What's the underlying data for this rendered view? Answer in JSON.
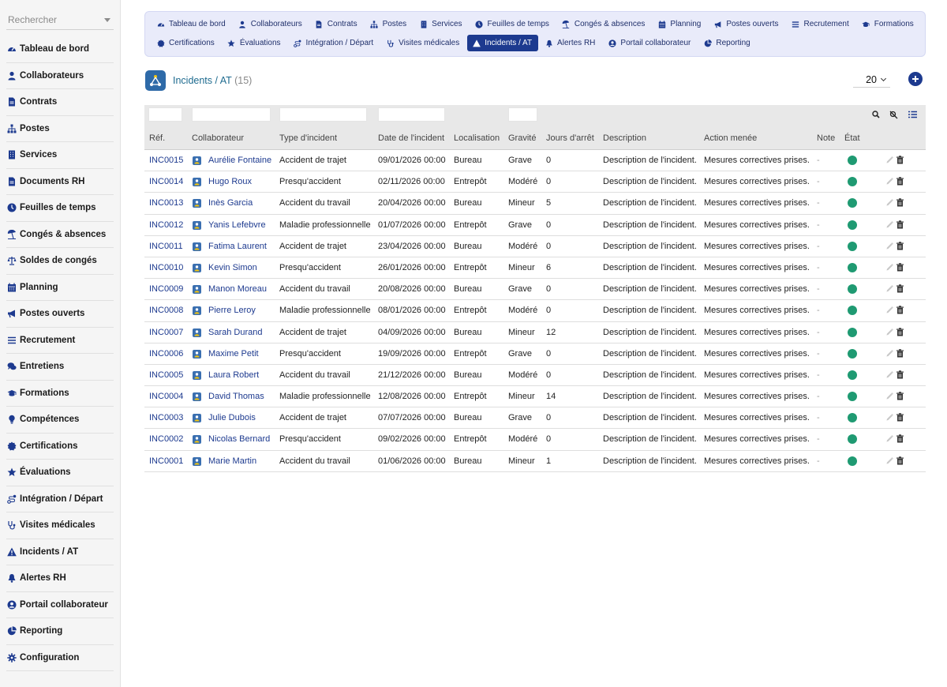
{
  "sidebar": {
    "search_placeholder": "Rechercher",
    "items": [
      {
        "label": "Tableau de bord",
        "icon": "dashboard-icon"
      },
      {
        "label": "Collaborateurs",
        "icon": "user-icon"
      },
      {
        "label": "Contrats",
        "icon": "document-icon"
      },
      {
        "label": "Postes",
        "icon": "sitemap-icon"
      },
      {
        "label": "Services",
        "icon": "building-icon"
      },
      {
        "label": "Documents RH",
        "icon": "document-icon"
      },
      {
        "label": "Feuilles de temps",
        "icon": "clock-icon"
      },
      {
        "label": "Congés & absences",
        "icon": "beach-umbrella-icon"
      },
      {
        "label": "Soldes de congés",
        "icon": "balance-scale-icon"
      },
      {
        "label": "Planning",
        "icon": "calendar-icon"
      },
      {
        "label": "Postes ouverts",
        "icon": "megaphone-icon"
      },
      {
        "label": "Recrutement",
        "icon": "list-icon"
      },
      {
        "label": "Entretiens",
        "icon": "chat-icon"
      },
      {
        "label": "Formations",
        "icon": "graduation-cap-icon"
      },
      {
        "label": "Compétences",
        "icon": "lightbulb-icon"
      },
      {
        "label": "Certifications",
        "icon": "certificate-icon"
      },
      {
        "label": "Évaluations",
        "icon": "star-icon"
      },
      {
        "label": "Intégration / Départ",
        "icon": "route-icon"
      },
      {
        "label": "Visites médicales",
        "icon": "stethoscope-icon"
      },
      {
        "label": "Incidents / AT",
        "icon": "warning-icon"
      },
      {
        "label": "Alertes RH",
        "icon": "bell-icon"
      },
      {
        "label": "Portail collaborateur",
        "icon": "user-circle-icon"
      },
      {
        "label": "Reporting",
        "icon": "pie-chart-icon"
      },
      {
        "label": "Configuration",
        "icon": "gear-icon"
      }
    ]
  },
  "topnav": {
    "row1": [
      {
        "label": "Tableau de bord",
        "icon": "dashboard-icon"
      },
      {
        "label": "Collaborateurs",
        "icon": "user-icon"
      },
      {
        "label": "Contrats",
        "icon": "document-icon"
      },
      {
        "label": "Postes",
        "icon": "sitemap-icon"
      },
      {
        "label": "Services",
        "icon": "building-icon"
      },
      {
        "label": "Feuilles de temps",
        "icon": "clock-icon"
      },
      {
        "label": "Congés & absences",
        "icon": "beach-umbrella-icon"
      },
      {
        "label": "Planning",
        "icon": "calendar-icon"
      },
      {
        "label": "Postes ouverts",
        "icon": "megaphone-icon"
      },
      {
        "label": "Recrutement",
        "icon": "list-icon"
      },
      {
        "label": "Formations",
        "icon": "graduation-cap-icon"
      }
    ],
    "row2": [
      {
        "label": "Certifications",
        "icon": "certificate-icon"
      },
      {
        "label": "Évaluations",
        "icon": "star-icon"
      },
      {
        "label": "Intégration / Départ",
        "icon": "route-icon"
      },
      {
        "label": "Visites médicales",
        "icon": "stethoscope-icon"
      },
      {
        "label": "Incidents / AT",
        "icon": "warning-icon",
        "active": true
      },
      {
        "label": "Alertes RH",
        "icon": "bell-icon"
      },
      {
        "label": "Portail collaborateur",
        "icon": "user-circle-icon"
      },
      {
        "label": "Reporting",
        "icon": "pie-chart-icon"
      }
    ]
  },
  "page": {
    "title": "Incidents / AT",
    "count": "(15)",
    "per_page": "20"
  },
  "colors": {
    "accent": "#1d3a8f",
    "nav_bg": "#e9ebfa",
    "state_ok": "#1f9a72",
    "title": "#1e6b8f"
  },
  "table": {
    "columns": [
      "Réf.",
      "Collaborateur",
      "Type d'incident",
      "Date de l'incident",
      "Localisation",
      "Gravité",
      "Jours d'arrêt",
      "Description",
      "Action menée",
      "Note",
      "État"
    ],
    "rows": [
      {
        "ref": "INC0015",
        "employee": "Aurélie Fontaine",
        "type": "Accident de trajet",
        "date": "09/01/2026 00:00",
        "location": "Bureau",
        "severity": "Grave",
        "days": "0",
        "description": "Description de l'incident.",
        "action": "Mesures correctives prises.",
        "note": "-"
      },
      {
        "ref": "INC0014",
        "employee": "Hugo Roux",
        "type": "Presqu'accident",
        "date": "02/11/2026 00:00",
        "location": "Entrepôt",
        "severity": "Modéré",
        "days": "0",
        "description": "Description de l'incident.",
        "action": "Mesures correctives prises.",
        "note": "-"
      },
      {
        "ref": "INC0013",
        "employee": "Inès Garcia",
        "type": "Accident du travail",
        "date": "20/04/2026 00:00",
        "location": "Bureau",
        "severity": "Mineur",
        "days": "5",
        "description": "Description de l'incident.",
        "action": "Mesures correctives prises.",
        "note": "-"
      },
      {
        "ref": "INC0012",
        "employee": "Yanis Lefebvre",
        "type": "Maladie professionnelle",
        "date": "01/07/2026 00:00",
        "location": "Entrepôt",
        "severity": "Grave",
        "days": "0",
        "description": "Description de l'incident.",
        "action": "Mesures correctives prises.",
        "note": "-"
      },
      {
        "ref": "INC0011",
        "employee": "Fatima Laurent",
        "type": "Accident de trajet",
        "date": "23/04/2026 00:00",
        "location": "Bureau",
        "severity": "Modéré",
        "days": "0",
        "description": "Description de l'incident.",
        "action": "Mesures correctives prises.",
        "note": "-"
      },
      {
        "ref": "INC0010",
        "employee": "Kevin Simon",
        "type": "Presqu'accident",
        "date": "26/01/2026 00:00",
        "location": "Entrepôt",
        "severity": "Mineur",
        "days": "6",
        "description": "Description de l'incident.",
        "action": "Mesures correctives prises.",
        "note": "-"
      },
      {
        "ref": "INC0009",
        "employee": "Manon Moreau",
        "type": "Accident du travail",
        "date": "20/08/2026 00:00",
        "location": "Bureau",
        "severity": "Grave",
        "days": "0",
        "description": "Description de l'incident.",
        "action": "Mesures correctives prises.",
        "note": "-"
      },
      {
        "ref": "INC0008",
        "employee": "Pierre Leroy",
        "type": "Maladie professionnelle",
        "date": "08/01/2026 00:00",
        "location": "Entrepôt",
        "severity": "Modéré",
        "days": "0",
        "description": "Description de l'incident.",
        "action": "Mesures correctives prises.",
        "note": "-"
      },
      {
        "ref": "INC0007",
        "employee": "Sarah Durand",
        "type": "Accident de trajet",
        "date": "04/09/2026 00:00",
        "location": "Bureau",
        "severity": "Mineur",
        "days": "12",
        "description": "Description de l'incident.",
        "action": "Mesures correctives prises.",
        "note": "-"
      },
      {
        "ref": "INC0006",
        "employee": "Maxime Petit",
        "type": "Presqu'accident",
        "date": "19/09/2026 00:00",
        "location": "Entrepôt",
        "severity": "Grave",
        "days": "0",
        "description": "Description de l'incident.",
        "action": "Mesures correctives prises.",
        "note": "-"
      },
      {
        "ref": "INC0005",
        "employee": "Laura Robert",
        "type": "Accident du travail",
        "date": "21/12/2026 00:00",
        "location": "Bureau",
        "severity": "Modéré",
        "days": "0",
        "description": "Description de l'incident.",
        "action": "Mesures correctives prises.",
        "note": "-"
      },
      {
        "ref": "INC0004",
        "employee": "David Thomas",
        "type": "Maladie professionnelle",
        "date": "12/08/2026 00:00",
        "location": "Entrepôt",
        "severity": "Mineur",
        "days": "14",
        "description": "Description de l'incident.",
        "action": "Mesures correctives prises.",
        "note": "-"
      },
      {
        "ref": "INC0003",
        "employee": "Julie Dubois",
        "type": "Accident de trajet",
        "date": "07/07/2026 00:00",
        "location": "Bureau",
        "severity": "Grave",
        "days": "0",
        "description": "Description de l'incident.",
        "action": "Mesures correctives prises.",
        "note": "-"
      },
      {
        "ref": "INC0002",
        "employee": "Nicolas Bernard",
        "type": "Presqu'accident",
        "date": "09/02/2026 00:00",
        "location": "Entrepôt",
        "severity": "Modéré",
        "days": "0",
        "description": "Description de l'incident.",
        "action": "Mesures correctives prises.",
        "note": "-"
      },
      {
        "ref": "INC0001",
        "employee": "Marie Martin",
        "type": "Accident du travail",
        "date": "01/06/2026 00:00",
        "location": "Bureau",
        "severity": "Mineur",
        "days": "1",
        "description": "Description de l'incident.",
        "action": "Mesures correctives prises.",
        "note": "-"
      }
    ]
  }
}
